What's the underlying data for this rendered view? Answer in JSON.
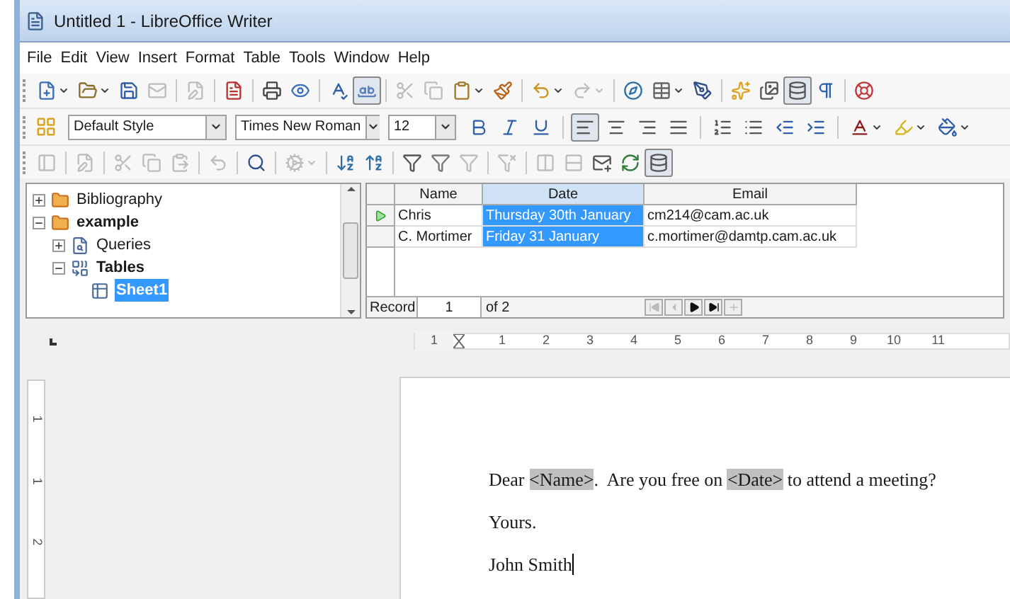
{
  "window": {
    "title": "Untitled 1 - LibreOffice Writer"
  },
  "menu": [
    "File",
    "Edit",
    "View",
    "Insert",
    "Format",
    "Table",
    "Tools",
    "Window",
    "Help"
  ],
  "standard_toolbar": [
    {
      "selected": false,
      "disabled": false
    },
    {
      "selected": false,
      "disabled": false
    },
    {
      "selected": false,
      "disabled": false
    },
    {
      "selected": false,
      "disabled": true
    },
    {
      "selected": false,
      "disabled": true
    },
    {
      "selected": false,
      "disabled": false
    },
    {
      "selected": false,
      "disabled": false
    },
    {
      "selected": false,
      "disabled": false
    },
    {
      "selected": false,
      "disabled": false
    },
    {
      "selected": true,
      "disabled": false
    },
    {
      "selected": false,
      "disabled": true
    },
    {
      "selected": false,
      "disabled": true
    },
    {
      "selected": false,
      "disabled": false
    },
    {
      "selected": false,
      "disabled": false
    },
    {
      "selected": false,
      "disabled": false
    },
    {
      "selected": false,
      "disabled": true
    },
    {
      "selected": false,
      "disabled": false
    },
    {
      "selected": false,
      "disabled": false
    },
    {
      "selected": false,
      "disabled": false
    },
    {
      "selected": false,
      "disabled": false
    },
    {
      "selected": false,
      "disabled": false
    },
    {
      "selected": true,
      "disabled": false
    },
    {
      "selected": false,
      "disabled": false
    },
    {
      "selected": false,
      "disabled": false
    }
  ],
  "formatting_toolbar": {
    "style": "Default Style",
    "font": "Times New Roman",
    "size": "12",
    "buttons": [
      {
        "selected": false
      },
      {
        "selected": false
      },
      {
        "selected": false
      },
      {
        "selected": true
      },
      {
        "selected": false
      },
      {
        "selected": false
      },
      {
        "selected": false
      },
      {
        "selected": false
      },
      {
        "selected": false
      },
      {
        "selected": false
      },
      {
        "selected": false
      },
      {
        "selected": false
      },
      {
        "selected": false
      },
      {
        "selected": false
      }
    ]
  },
  "data_toolbar": [
    {
      "selected": false,
      "disabled": true
    },
    {
      "selected": false,
      "disabled": true
    },
    {
      "selected": false,
      "disabled": true
    },
    {
      "selected": false,
      "disabled": true
    },
    {
      "selected": false,
      "disabled": true
    },
    {
      "selected": false,
      "disabled": true
    },
    {
      "selected": false,
      "disabled": false
    },
    {
      "selected": false,
      "disabled": true
    },
    {
      "selected": false,
      "disabled": false
    },
    {
      "selected": false,
      "disabled": false
    },
    {
      "selected": false,
      "disabled": false
    },
    {
      "selected": false,
      "disabled": false
    },
    {
      "selected": false,
      "disabled": true
    },
    {
      "selected": false,
      "disabled": true
    },
    {
      "selected": false,
      "disabled": true
    },
    {
      "selected": false,
      "disabled": true
    },
    {
      "selected": false,
      "disabled": false
    },
    {
      "selected": false,
      "disabled": false
    },
    {
      "selected": true,
      "disabled": false
    }
  ],
  "data_sources": [
    {
      "label": "Bibliography",
      "kind": "database",
      "expanded": false,
      "selected": false
    },
    {
      "label": "example",
      "kind": "database",
      "expanded": true,
      "selected": false,
      "children": [
        {
          "label": "Queries",
          "kind": "queries",
          "expanded": false,
          "selected": false
        },
        {
          "label": "Tables",
          "kind": "tables",
          "expanded": true,
          "selected": false,
          "children": [
            {
              "label": "Sheet1",
              "kind": "table",
              "selected": true
            }
          ]
        }
      ]
    }
  ],
  "table": {
    "columns": [
      {
        "label": "Name",
        "selected": false
      },
      {
        "label": "Date",
        "selected": true
      },
      {
        "label": "Email",
        "selected": false
      }
    ],
    "rows": [
      {
        "current": true,
        "cells": [
          "Chris",
          "Thursday 30th January",
          "cm214@cam.ac.uk"
        ]
      },
      {
        "current": false,
        "cells": [
          "C. Mortimer",
          "Friday 31 January",
          "c.mortimer@damtp.cam.ac.uk"
        ]
      }
    ],
    "record_label": "Record",
    "record": "1",
    "record_total": "of 2",
    "nav": [
      {
        "disabled": true
      },
      {
        "disabled": true
      },
      {
        "disabled": false
      },
      {
        "disabled": false
      },
      {
        "disabled": true
      }
    ]
  },
  "ruler": {
    "indent_label": "1",
    "ticks": [
      "1",
      "2",
      "3",
      "4",
      "5",
      "6",
      "7",
      "8",
      "9",
      "10",
      "11"
    ]
  },
  "vertical_ruler": [
    "1",
    "1",
    "2"
  ],
  "document": {
    "paragraphs": [
      [
        {
          "kind": "text",
          "text": "Dear "
        },
        {
          "kind": "field",
          "text": "<Name>"
        },
        {
          "kind": "text",
          "text": ".  Are you free on "
        },
        {
          "kind": "field",
          "text": "<Date>"
        },
        {
          "kind": "text",
          "text": " to attend a meeting?"
        }
      ],
      [
        {
          "kind": "text",
          "text": "Yours."
        }
      ],
      [
        {
          "kind": "text",
          "text": "John Smith"
        }
      ]
    ],
    "cursor": true
  }
}
